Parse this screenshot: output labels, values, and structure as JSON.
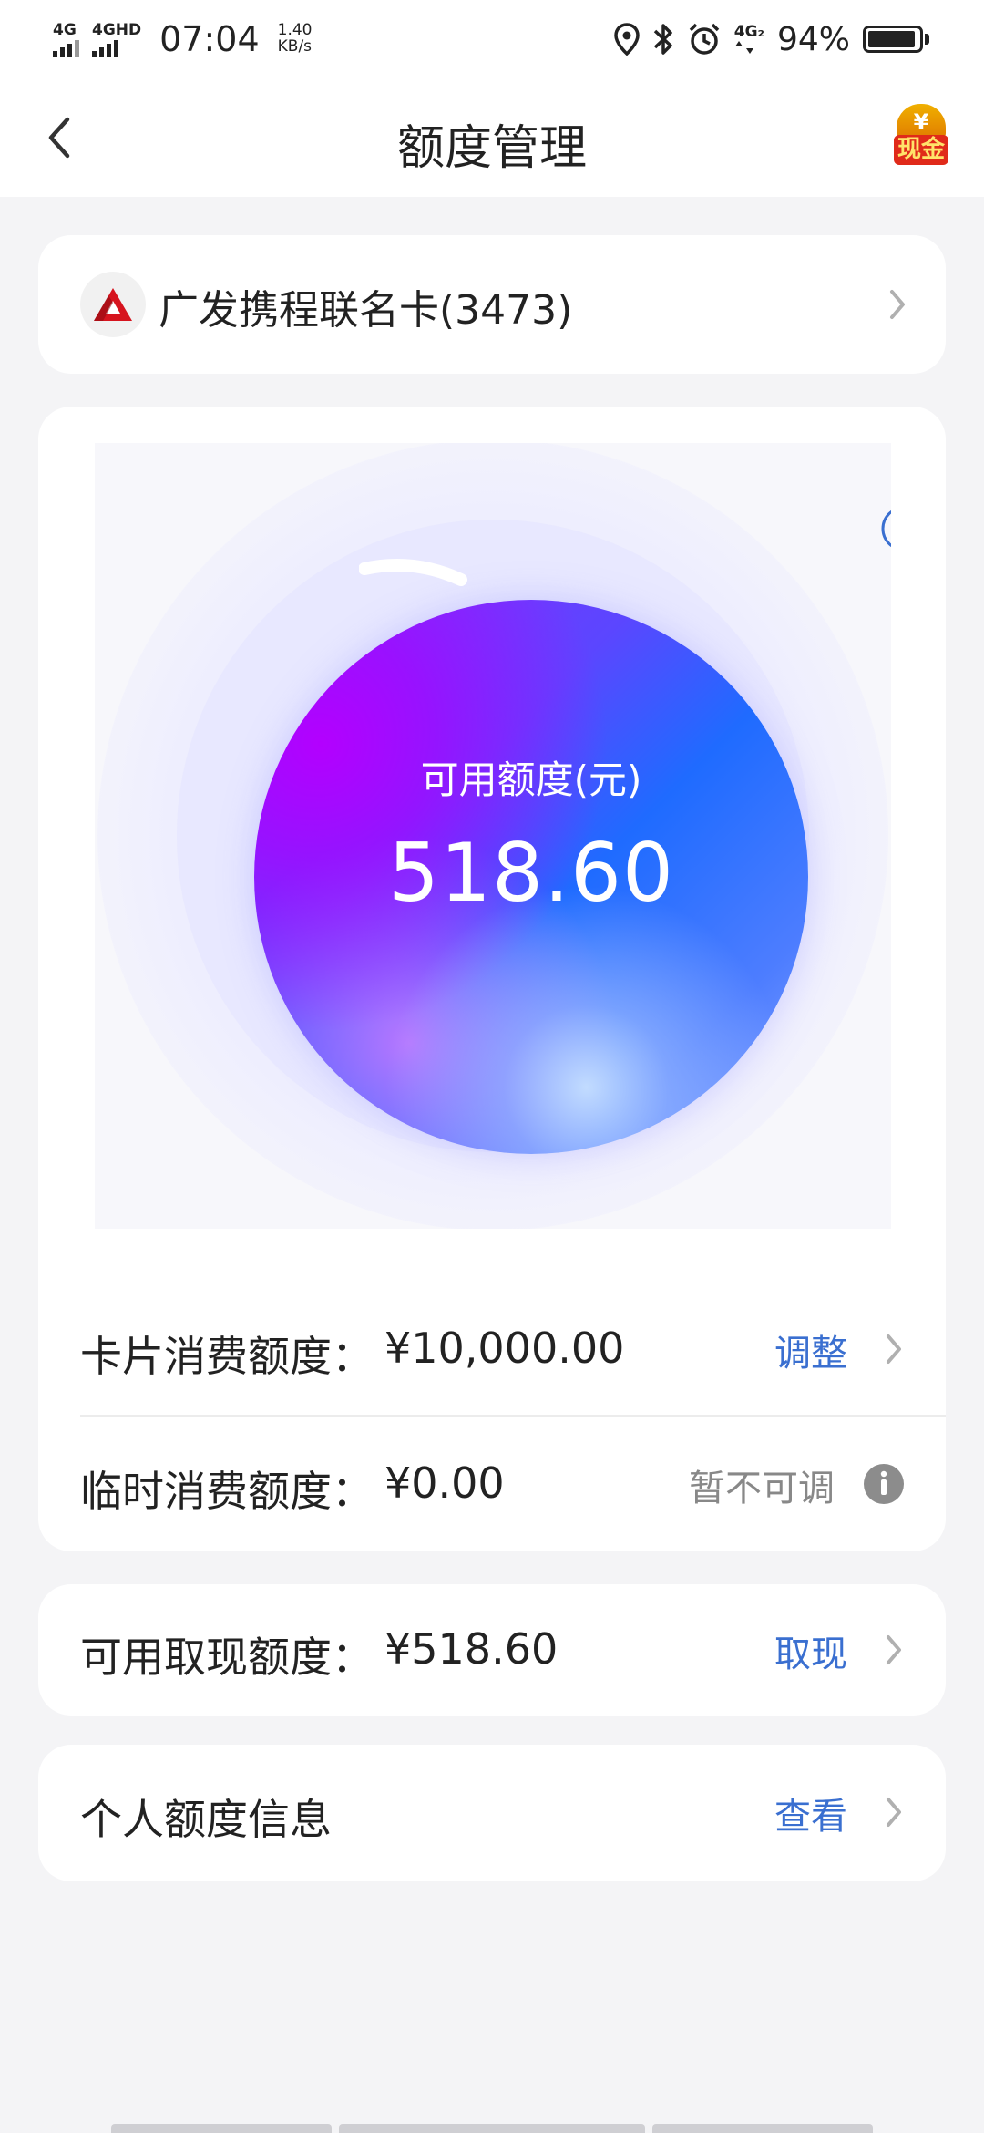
{
  "status_bar": {
    "sim1": "4G",
    "sim2": "4GHD",
    "time": "07:04",
    "speed_value": "1.40",
    "speed_unit": "KB/s",
    "sim2_small": "4G₂",
    "battery_percent": "94%",
    "battery_level": 0.94,
    "icons": [
      "location-icon",
      "bluetooth-icon",
      "alarm-icon"
    ]
  },
  "nav": {
    "title": "额度管理",
    "badge_label": "现金",
    "badge_symbol": "¥"
  },
  "card_selector": {
    "name": "广发携程联名卡(3473)"
  },
  "credit_visual": {
    "label": "可用额度(元)",
    "value": "518.60"
  },
  "limits": {
    "spend": {
      "label": "卡片消费额度：",
      "value": "¥10,000.00",
      "action": "调整"
    },
    "temporary": {
      "label": "临时消费额度：",
      "value": "¥0.00",
      "action": "暂不可调"
    }
  },
  "cash": {
    "label": "可用取现额度：",
    "value": "¥518.60",
    "action": "取现"
  },
  "personal": {
    "label": "个人额度信息",
    "action": "查看"
  },
  "colors": {
    "accent": "#3a6fd0",
    "bank_red": "#d6141e",
    "background": "#f4f4f6"
  }
}
